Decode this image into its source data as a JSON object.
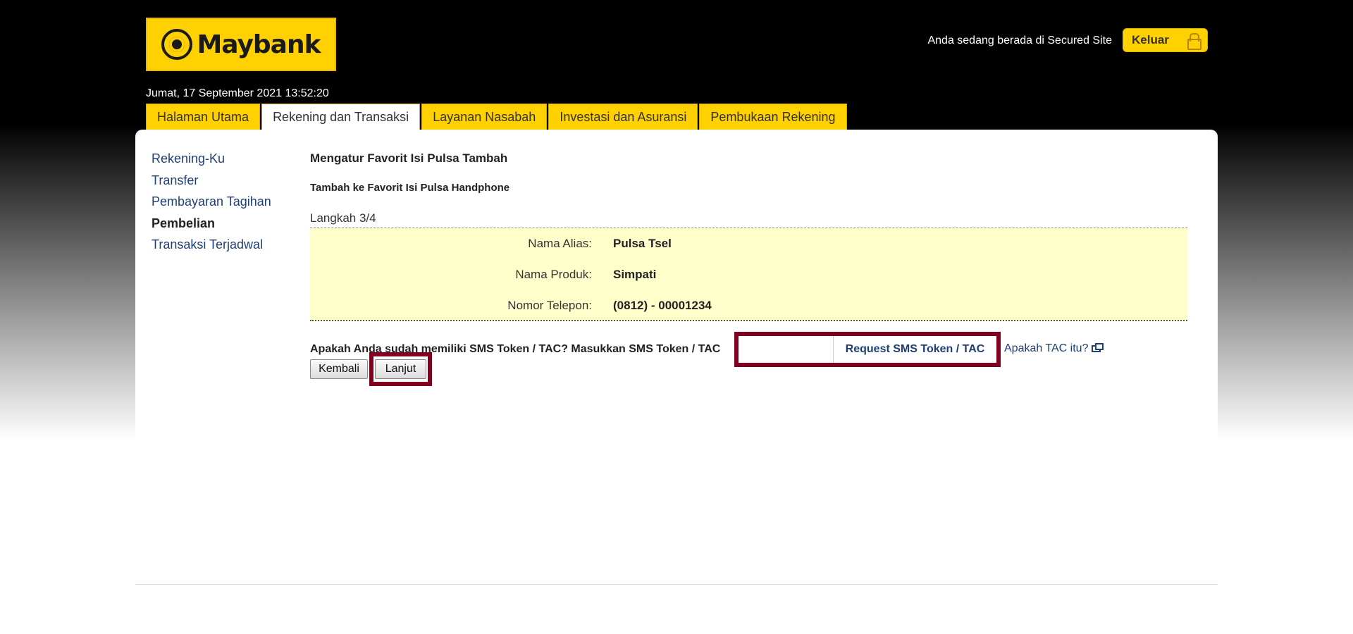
{
  "brand": {
    "name": "Maybank"
  },
  "header": {
    "secured_text": "Anda sedang berada di Secured Site",
    "logout_label": "Keluar",
    "datetime": "Jumat, 17 September 2021 13:52:20"
  },
  "tabs": [
    {
      "label": "Halaman Utama"
    },
    {
      "label": "Rekening dan Transaksi"
    },
    {
      "label": "Layanan Nasabah"
    },
    {
      "label": "Investasi dan Asuransi"
    },
    {
      "label": "Pembukaan Rekening"
    }
  ],
  "sidebar": {
    "items": [
      {
        "label": "Rekening-Ku"
      },
      {
        "label": "Transfer"
      },
      {
        "label": "Pembayaran Tagihan"
      },
      {
        "label": "Pembelian"
      },
      {
        "label": "Transaksi Terjadwal"
      }
    ]
  },
  "main": {
    "title": "Mengatur Favorit Isi Pulsa Tambah",
    "subtitle": "Tambah ke Favorit Isi Pulsa Handphone",
    "step": "Langkah 3/4",
    "summary": [
      {
        "label": "Nama Alias:",
        "value": "Pulsa Tsel"
      },
      {
        "label": "Nama Produk:",
        "value": "Simpati"
      },
      {
        "label": "Nomor Telepon:",
        "value": "(0812) - 00001234"
      }
    ],
    "tac": {
      "prompt": "Apakah Anda sudah memiliki SMS Token / TAC? Masukkan SMS Token / TAC",
      "input_value": "",
      "request_label": "Request SMS Token / TAC",
      "help_label": "Apakah TAC itu?"
    },
    "buttons": {
      "back": "Kembali",
      "next": "Lanjut"
    }
  }
}
